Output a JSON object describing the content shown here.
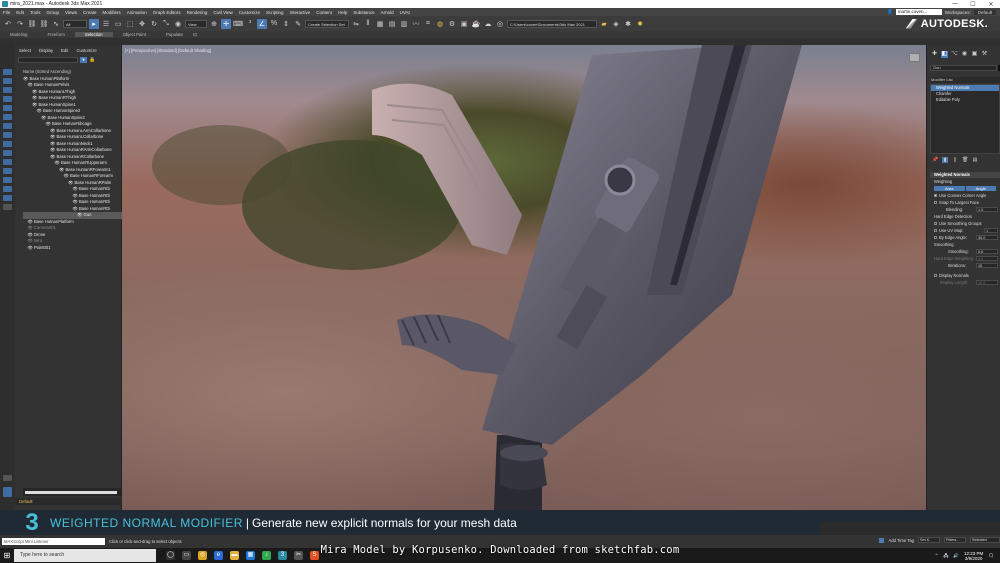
{
  "window": {
    "title": "mira_2021.max - Autodesk 3ds Max 2021",
    "minimize": "—",
    "maximize": "☐",
    "close": "✕"
  },
  "menu": {
    "items": [
      "File",
      "Edit",
      "Tools",
      "Group",
      "Views",
      "Create",
      "Modifiers",
      "Animation",
      "Graph Editors",
      "Rendering",
      "Civil View",
      "Customize",
      "Scripting",
      "Interactive",
      "Content",
      "Help",
      "Substance",
      "Arnold",
      "UVAt"
    ],
    "signin_user": "martin.coven...",
    "workspaces_label": "Workspaces:",
    "workspaces_value": "Default"
  },
  "toolbar": {
    "filter_value": "All",
    "view_value": "View",
    "selection_set_value": "Create Selection Set",
    "project_path": "C:\\Users\\coven\\Documents\\3ds Max 2021"
  },
  "brand": {
    "name": "AUTODESK."
  },
  "ribbon": {
    "tabs": [
      "Modeling",
      "Freeform",
      "Selection",
      "Object Paint",
      "Populate"
    ],
    "active": "Selection"
  },
  "explorer": {
    "tabs": [
      "Select",
      "Display",
      "Edit",
      "Customize"
    ],
    "header": "Name (Sorted Ascending)",
    "rows": [
      {
        "label": "Base HumanPlatform",
        "dim": false,
        "sel": false,
        "indent": 0
      },
      {
        "label": "Base HumanPelvis",
        "dim": false,
        "sel": false,
        "indent": 1
      },
      {
        "label": "Base HumanLThigh",
        "dim": false,
        "sel": false,
        "indent": 2
      },
      {
        "label": "Base HumanRThigh",
        "dim": false,
        "sel": false,
        "indent": 2
      },
      {
        "label": "Base HumanSpine1",
        "dim": false,
        "sel": false,
        "indent": 2
      },
      {
        "label": "Base HumanSpine2",
        "dim": false,
        "sel": false,
        "indent": 3
      },
      {
        "label": "Base HumanSpine3",
        "dim": false,
        "sel": false,
        "indent": 4
      },
      {
        "label": "Base HumanRibcage",
        "dim": false,
        "sel": false,
        "indent": 5
      },
      {
        "label": "Base HumanLArmCollarbone",
        "dim": false,
        "sel": false,
        "indent": 6
      },
      {
        "label": "Base HumanLCollarbone",
        "dim": false,
        "sel": false,
        "indent": 6
      },
      {
        "label": "Base HumanNeck1",
        "dim": false,
        "sel": false,
        "indent": 6
      },
      {
        "label": "Base HumanRArmCollarbone",
        "dim": false,
        "sel": false,
        "indent": 6
      },
      {
        "label": "Base HumanRCollarbone",
        "dim": false,
        "sel": false,
        "indent": 6
      },
      {
        "label": "Base HumanRUpperarm",
        "dim": false,
        "sel": false,
        "indent": 7
      },
      {
        "label": "Base HumanRForearm1",
        "dim": false,
        "sel": false,
        "indent": 8
      },
      {
        "label": "Base HumanRForearm",
        "dim": false,
        "sel": false,
        "indent": 9
      },
      {
        "label": "Base HumanRPalm",
        "dim": false,
        "sel": false,
        "indent": 10
      },
      {
        "label": "Base HumanRDi",
        "dim": false,
        "sel": false,
        "indent": 11
      },
      {
        "label": "Base HumanRDi",
        "dim": false,
        "sel": false,
        "indent": 11
      },
      {
        "label": "Base HumanRDi",
        "dim": false,
        "sel": false,
        "indent": 11
      },
      {
        "label": "Base HumanRDi",
        "dim": false,
        "sel": false,
        "indent": 11
      },
      {
        "label": "Gun",
        "dim": false,
        "sel": true,
        "indent": 12
      },
      {
        "label": "Base HumanPlatform",
        "dim": false,
        "sel": false,
        "indent": 1
      },
      {
        "label": "Camera001",
        "dim": true,
        "sel": false,
        "indent": 1
      },
      {
        "label": "Drone",
        "dim": false,
        "sel": false,
        "indent": 1
      },
      {
        "label": "Mira",
        "dim": true,
        "sel": false,
        "indent": 1
      },
      {
        "label": "Point001",
        "dim": false,
        "sel": false,
        "indent": 1
      }
    ],
    "layer": "Default"
  },
  "viewport": {
    "label": "[+] [Perspective] [Standard] [Default Shading]"
  },
  "command_panel": {
    "object_name": "Gun",
    "modifier_list": "Modifier List",
    "stack": [
      {
        "label": "Weighted Normals",
        "sel": true
      },
      {
        "label": "Chamfer",
        "sel": false
      },
      {
        "label": "Editable Poly",
        "sel": false
      }
    ],
    "rollout_title": "Weighted Normals",
    "weighting_label": "Weighting",
    "area_button": "Area",
    "angle_button": "Angle",
    "use_convex": "Use Convex Corner Angle",
    "snap_largest": "Snap To Largest Face",
    "blending_label": "Blending:",
    "blending_value": "1.0",
    "hard_edge_label": "Hard Edge Detection",
    "use_smoothing_groups": "Use Smoothing Groups",
    "use_uv_map": "Use UV Map:",
    "uv_map_value": "1",
    "by_edge_angle": "By Edge Angle:",
    "edge_angle_value": "30.0",
    "smoothing_label": "Smoothing",
    "smoothing_field_label": "Smoothing:",
    "smoothing_value": "0.0",
    "hard_edge_weighting": "Hard Edge Weighting:",
    "hard_edge_value": "0.0",
    "iterations_label": "Iterations:",
    "iterations_value": "10",
    "display_normals": "Display Normals",
    "display_length": "Display Length:",
    "display_length_value": "10.0"
  },
  "caption": {
    "number": "3",
    "title": "WEIGHTED NORMAL MODIFIER",
    "separator": "|",
    "description": "Generate new explicit normals for your mesh data"
  },
  "credit": "Mira Model by Korpusenko. Downloaded from sketchfab.com",
  "statusbar": {
    "maxscript_placeholder": "MAXScript Mini Listener",
    "message": "Click or click-and-drag to select objects",
    "add_time_tag": "Add Time Tag",
    "setk": "Set K.",
    "filters": "Filters...",
    "selected": "Selected"
  },
  "taskbar": {
    "search_placeholder": "Type here to search",
    "time": "12:23 PM",
    "date": "3/9/2020"
  },
  "colors": {
    "accent": "#4c7ab3",
    "caption_cyan": "#4ac0d8",
    "background": "#2b2b2b"
  }
}
